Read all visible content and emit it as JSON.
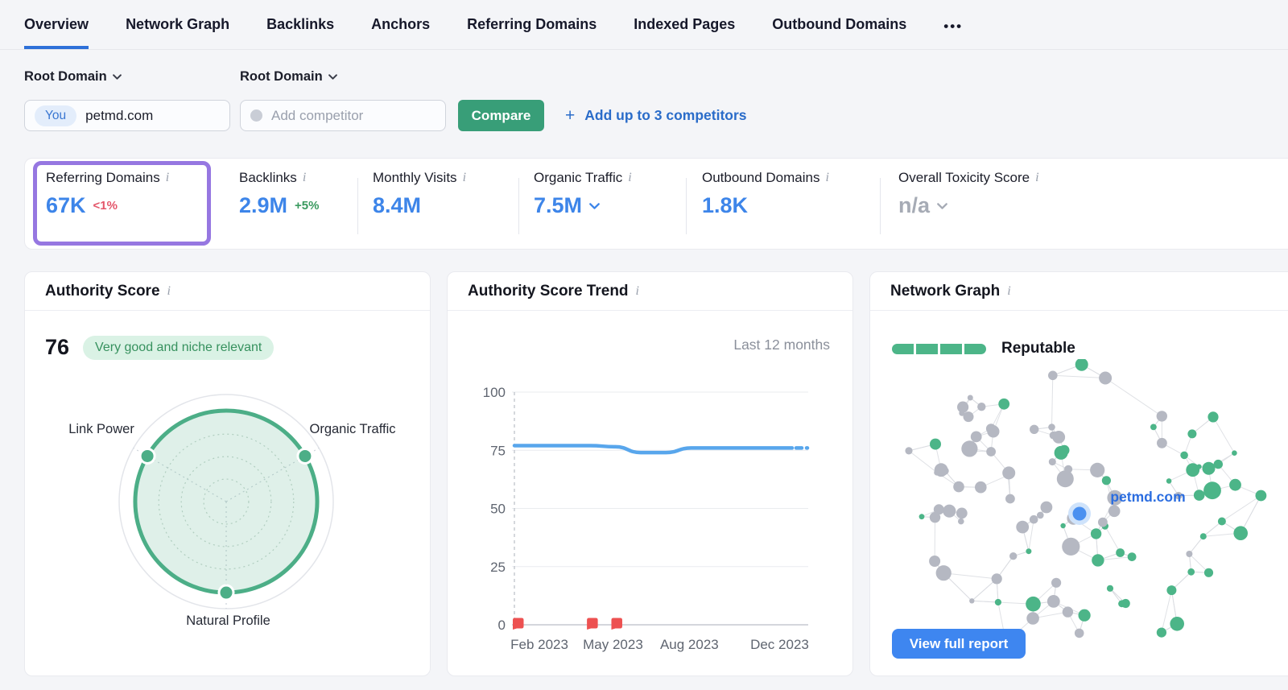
{
  "nav": {
    "tabs": [
      {
        "label": "Overview",
        "active": true
      },
      {
        "label": "Network Graph",
        "active": false
      },
      {
        "label": "Backlinks",
        "active": false
      },
      {
        "label": "Anchors",
        "active": false
      },
      {
        "label": "Referring Domains",
        "active": false
      },
      {
        "label": "Indexed Pages",
        "active": false
      },
      {
        "label": "Outbound Domains",
        "active": false
      }
    ],
    "more": "•••"
  },
  "filters": {
    "you_scope_label": "Root Domain",
    "competitor_scope_label": "Root Domain",
    "you_badge": "You",
    "you_domain": "petmd.com",
    "competitor_placeholder": "Add competitor",
    "compare_button": "Compare",
    "add_competitors_plus": "+",
    "add_competitors_label": "Add up to 3 competitors"
  },
  "metrics": [
    {
      "label": "Referring Domains",
      "value": "67K",
      "delta": "<1%",
      "highlighted": true
    },
    {
      "label": "Backlinks",
      "value": "2.9M",
      "delta": "+5%"
    },
    {
      "label": "Monthly Visits",
      "value": "8.4M"
    },
    {
      "label": "Organic Traffic",
      "value": "7.5M"
    },
    {
      "label": "Outbound Domains",
      "value": "1.8K"
    },
    {
      "label": "Overall Toxicity Score",
      "value": "n/a"
    }
  ],
  "cards": {
    "authority_score": {
      "title": "Authority Score",
      "score": "76",
      "badge": "Very good and niche relevant",
      "axis_left": "Link Power",
      "axis_right": "Organic Traffic",
      "axis_bottom": "Natural Profile"
    },
    "trend": {
      "title": "Authority Score Trend",
      "period": "Last 12 months"
    },
    "network": {
      "title": "Network Graph",
      "status": "Reputable",
      "center_label": "petmd.com",
      "button": "View full report"
    }
  },
  "colors": {
    "accent_blue": "#3d85e9",
    "link_blue": "#2a6cc9",
    "trend_line_blue": "#58a6ec",
    "button_blue": "#3e86f0",
    "node_blue": "#4a90f0",
    "green": "#4cb588",
    "radar_green": "#4cae87",
    "compare_green": "#389e78",
    "badge_green_bg": "#daf2e5",
    "delta_green": "#3a9a5f",
    "delta_red": "#e4566a",
    "note_red": "#ed5151",
    "highlight_purple": "#9677e1",
    "node_gray": "#b5b8c2",
    "edge_gray": "#dadce1"
  },
  "chart_data": [
    {
      "type": "radar",
      "title": "Authority Score",
      "axes": [
        "Link Power",
        "Organic Traffic",
        "Natural Profile"
      ],
      "values": [
        85,
        85,
        85
      ],
      "max": 100,
      "rings": 3,
      "fill": "rgba(76,174,135,0.18)",
      "stroke": "#4cae87"
    },
    {
      "type": "line",
      "title": "Authority Score Trend",
      "subtitle": "Last 12 months",
      "values": [
        77,
        77,
        77,
        77,
        76.5,
        74,
        74,
        76,
        76,
        76,
        76,
        76
      ],
      "ylim": [
        0,
        100
      ],
      "yticks": [
        100,
        75,
        50,
        25,
        0
      ],
      "xtick_labels": [
        "Feb 2023",
        "May 2023",
        "Aug 2023",
        "Dec 2023"
      ],
      "xtick_positions": [
        0.09,
        0.355,
        0.63,
        0.955
      ],
      "note_positions": [
        0.0,
        0.267,
        0.355
      ],
      "last_segment_dashed": true,
      "grid": true,
      "legend": "none"
    }
  ]
}
